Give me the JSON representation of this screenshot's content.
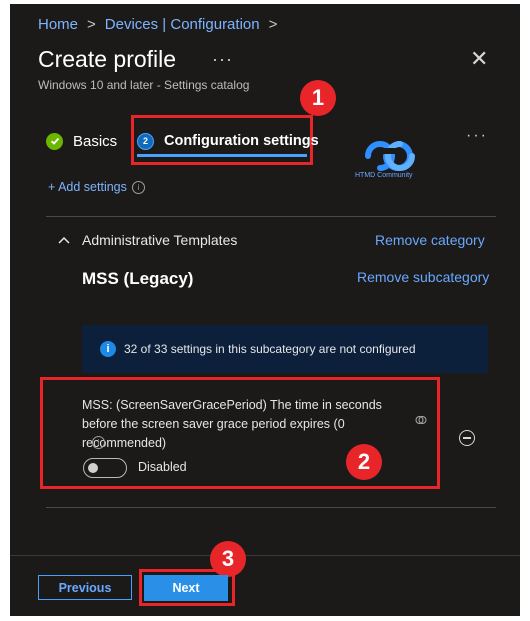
{
  "breadcrumb": {
    "items": [
      "Home",
      "Devices | Configuration"
    ],
    "separator": ">"
  },
  "header": {
    "title": "Create profile",
    "more": "···",
    "subtitle": "Windows 10 and later - Settings catalog",
    "close": "✕"
  },
  "tabs": {
    "items": [
      {
        "label": "Basics",
        "state": "completed"
      },
      {
        "label": "Configuration settings",
        "step": "2",
        "state": "active"
      }
    ],
    "more": "···"
  },
  "logo": {
    "text": "HTMD Community"
  },
  "actions": {
    "add_settings": "+ Add settings"
  },
  "category": {
    "name": "Administrative Templates",
    "remove_label": "Remove category"
  },
  "subcategory": {
    "name": "MSS (Legacy)",
    "remove_label": "Remove subcategory"
  },
  "info_banner": {
    "text": "32 of 33 settings in this subcategory are not configured"
  },
  "setting": {
    "description": "MSS: (ScreenSaverGracePeriod) The time in seconds before the screen saver grace period expires (0 recommended)",
    "toggle_label": "Disabled",
    "toggle_on": false
  },
  "footer": {
    "previous_label": "Previous",
    "next_label": "Next"
  },
  "annotations": [
    "1",
    "2",
    "3"
  ],
  "colors": {
    "background": "#1b1a19",
    "accent": "#4aa0ff",
    "annotation_red": "#e8262a",
    "info_bar": "#0c1f3b",
    "success": "#6bb700"
  }
}
